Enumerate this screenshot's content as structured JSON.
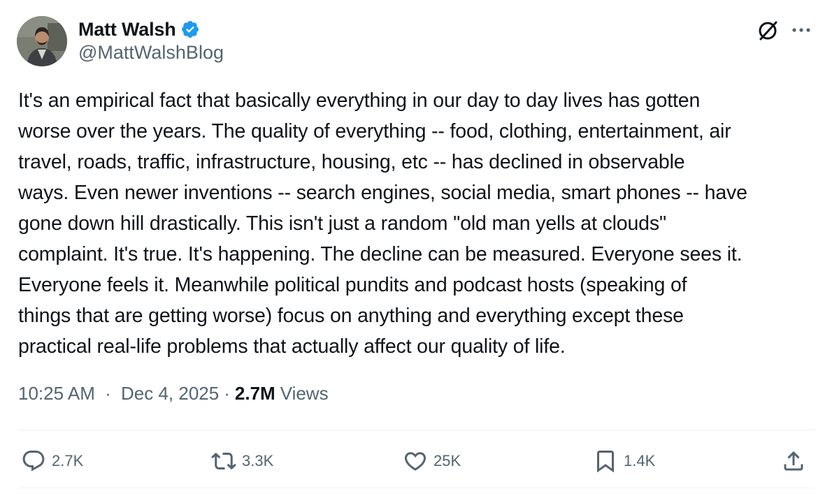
{
  "author": {
    "display_name": "Matt Walsh",
    "handle": "@MattWalshBlog",
    "verified": true,
    "verified_color": "#1d9bf0"
  },
  "tweet": {
    "lines": [
      "It's an empirical fact that basically everything in our day to day lives has gotten",
      "worse over the years. The quality of everything -- food, clothing, entertainment, air",
      "travel, roads, traffic, infrastructure, housing, etc -- has declined in observable",
      "ways. Even newer inventions -- search engines, social media, smart phones -- have",
      "gone down hill drastically. This isn't just a random \"old man yells at clouds\"",
      "complaint. It's true. It's happening. The decline can be measured. Everyone sees it.",
      "Everyone feels it. Meanwhile political pundits and podcast hosts (speaking of",
      "things that are getting worse) focus on anything and everything except these",
      "practical real-life problems that actually affect our quality of life."
    ]
  },
  "meta": {
    "time": "10:25 AM",
    "separator": "·",
    "date": "Dec 4, 2025",
    "views_count": "2.7M",
    "views_label": "Views"
  },
  "actions": {
    "reply": {
      "icon": "reply-icon",
      "count": "2.7K"
    },
    "repost": {
      "icon": "repost-icon",
      "count": "3.3K"
    },
    "like": {
      "icon": "heart-icon",
      "count": "25K"
    },
    "bookmark": {
      "icon": "bookmark-icon",
      "count": "1.4K"
    },
    "share": {
      "icon": "share-icon"
    }
  },
  "colors": {
    "text_primary": "#0f1419",
    "text_secondary": "#536471",
    "divider": "#eff3f4"
  }
}
